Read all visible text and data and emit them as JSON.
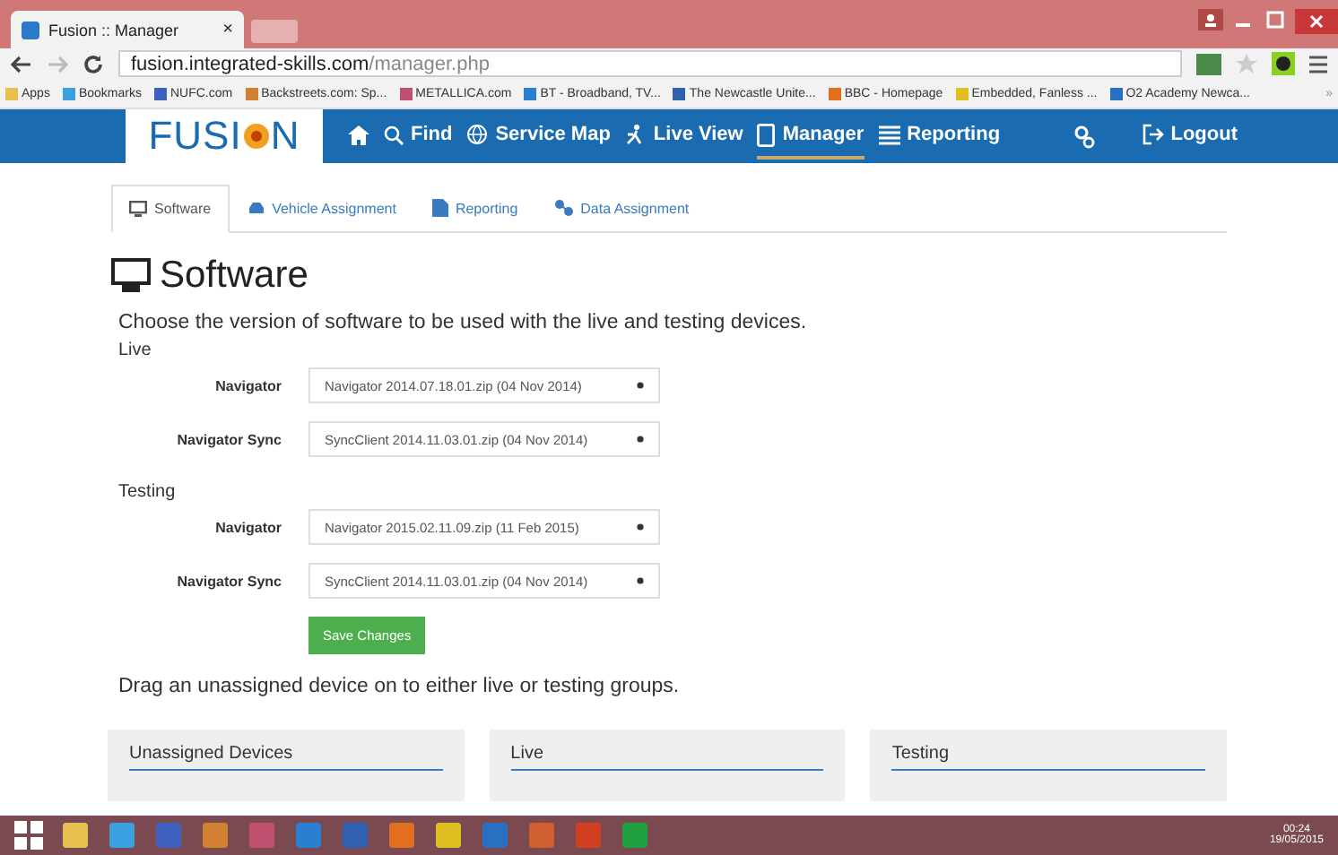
{
  "browser": {
    "tab_title": "Fusion :: Manager",
    "tab_close": "×",
    "url_host": "fusion.integrated-skills.com",
    "url_path": "/manager.php",
    "bookmarks": [
      "Apps",
      "Bookmarks",
      "NUFC.com",
      "Backstreets.com: Sp...",
      "METALLICA.com",
      "BT - Broadband, TV...",
      "The Newcastle Unite...",
      "BBC - Homepage",
      "Embedded, Fanless ...",
      "O2 Academy Newca..."
    ],
    "more": "»"
  },
  "nav": {
    "logo_start": "FUSI",
    "logo_end": "N",
    "items": [
      {
        "kind": "home",
        "selected": false
      },
      {
        "label": "Find",
        "kind": "search",
        "selected": false
      },
      {
        "label": "Service Map",
        "kind": "globe",
        "selected": false
      },
      {
        "label": "Live View",
        "kind": "walk",
        "selected": false
      },
      {
        "label": "Manager",
        "kind": "device",
        "selected": true
      },
      {
        "label": "Reporting",
        "kind": "list",
        "selected": false
      }
    ],
    "logout": "Logout"
  },
  "tabs": [
    {
      "label": "Software",
      "kind": "monitor",
      "selected": true
    },
    {
      "label": "Vehicle Assignment",
      "kind": "car",
      "selected": false
    },
    {
      "label": "Reporting",
      "kind": "doc",
      "selected": false
    },
    {
      "label": "Data Assignment",
      "kind": "share",
      "selected": false
    }
  ],
  "heading": "Software",
  "intro": "Choose the version of software to be used with the live and testing devices.",
  "groups": [
    {
      "title": "Live",
      "rows": [
        {
          "label": "Navigator",
          "value": "Navigator 2014.07.18.01.zip (04 Nov 2014)"
        },
        {
          "label": "Navigator Sync",
          "value": "SyncClient 2014.11.03.01.zip (04 Nov 2014)"
        }
      ]
    },
    {
      "title": "Testing",
      "rows": [
        {
          "label": "Navigator",
          "value": "Navigator 2015.02.11.09.zip (11 Feb 2015)"
        },
        {
          "label": "Navigator Sync",
          "value": "SyncClient 2014.11.03.01.zip (04 Nov 2014)"
        }
      ]
    }
  ],
  "save_button": "Save Changes",
  "drag_note": "Drag an unassigned device on to either live or testing groups.",
  "panels": [
    "Unassigned Devices",
    "Live",
    "Testing"
  ],
  "taskbar": {
    "time": "00:24",
    "date": "19/05/2015"
  }
}
